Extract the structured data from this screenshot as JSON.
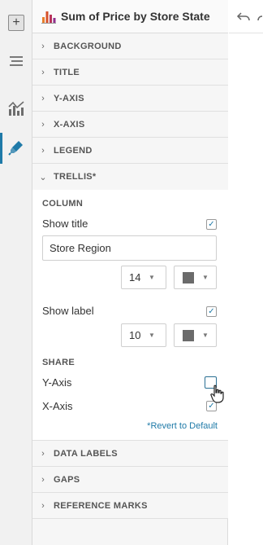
{
  "panel": {
    "title": "Sum of Price by Store State"
  },
  "sections_top": [
    {
      "label": "BACKGROUND"
    },
    {
      "label": "TITLE"
    },
    {
      "label": "Y-AXIS"
    },
    {
      "label": "X-AXIS"
    },
    {
      "label": "LEGEND"
    }
  ],
  "trellis": {
    "label": "TRELLIS*",
    "column_heading": "COLUMN",
    "show_title_label": "Show title",
    "title_value": "Store Region",
    "title_font_size": "14",
    "show_label_label": "Show label",
    "label_font_size": "10",
    "share_heading": "SHARE",
    "y_axis_label": "Y-Axis",
    "x_axis_label": "X-Axis",
    "revert_label": "*Revert to Default"
  },
  "sections_bottom": [
    {
      "label": "DATA LABELS"
    },
    {
      "label": "GAPS"
    },
    {
      "label": "REFERENCE MARKS"
    }
  ],
  "glyphs": {
    "plus": "+",
    "chevron_right": "›",
    "chevron_down": "⌄",
    "check": "✓",
    "caret": "▼"
  }
}
